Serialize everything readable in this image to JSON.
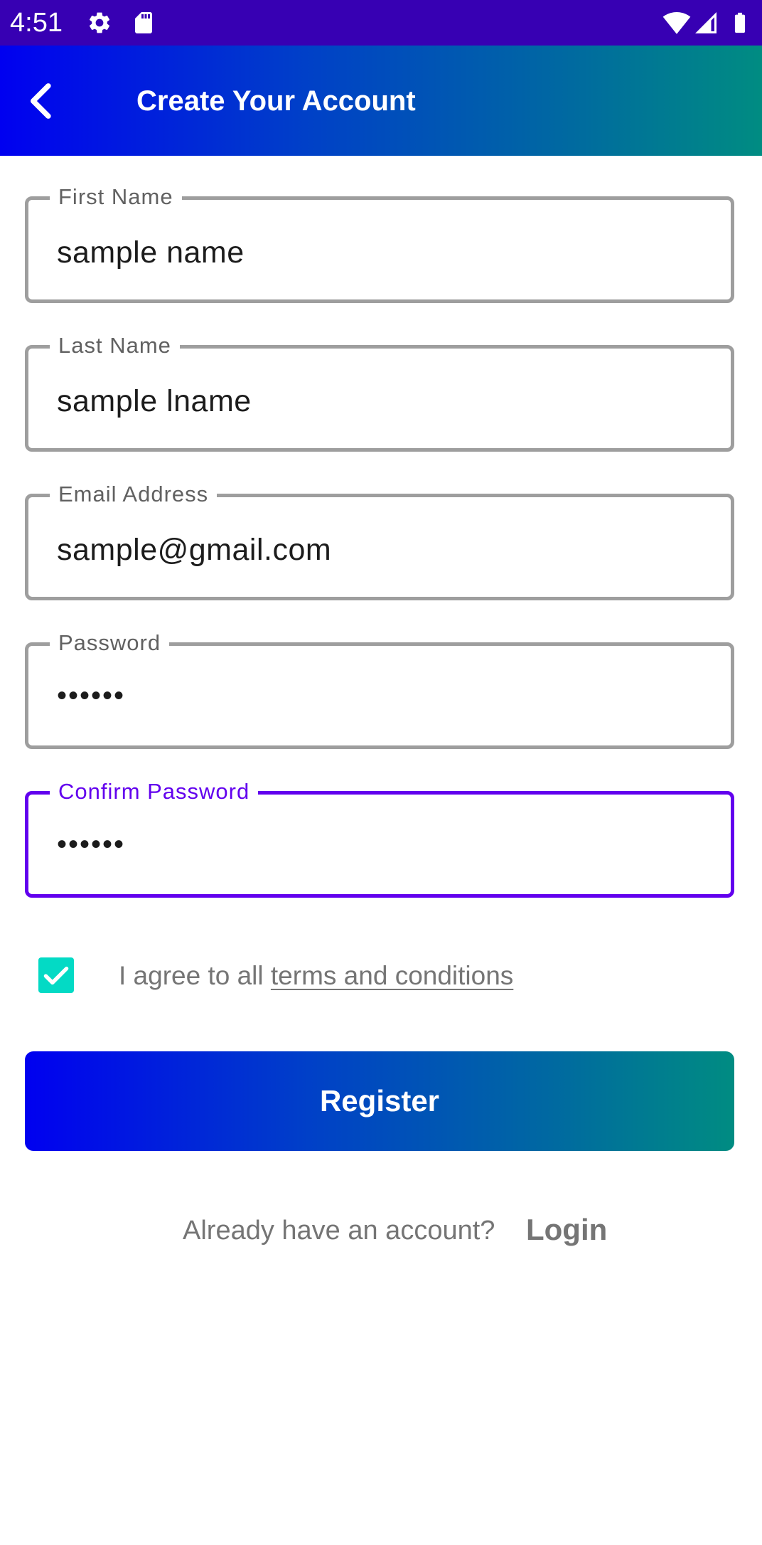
{
  "status_bar": {
    "time": "4:51",
    "icons": [
      "gear-icon",
      "sd-card-icon",
      "wifi-icon",
      "cellular-signal-icon",
      "battery-icon"
    ]
  },
  "app_bar": {
    "title": "Create Your Account",
    "back_icon": "chevron-left-icon",
    "gradient_start": "#0000f0",
    "gradient_end": "#008c82"
  },
  "form": {
    "first_name": {
      "label": "First Name",
      "value": "sample name"
    },
    "last_name": {
      "label": "Last Name",
      "value": "sample lname"
    },
    "email": {
      "label": "Email Address",
      "value": "sample@gmail.com"
    },
    "password": {
      "label": "Password",
      "value": "••••••"
    },
    "confirm_password": {
      "label": "Confirm Password",
      "value": "••••••",
      "focused": true
    }
  },
  "terms": {
    "checked": true,
    "prefix": "I agree to all ",
    "link": "terms and conditions"
  },
  "register_button": {
    "label": "Register"
  },
  "login_prompt": {
    "text": "Already have an account?",
    "link": "Login"
  },
  "colors": {
    "status_bar": "#3700b3",
    "focus_accent": "#6200ee",
    "checkbox": "#03dac5",
    "field_border": "#9e9e9e",
    "muted_text": "#757575"
  }
}
